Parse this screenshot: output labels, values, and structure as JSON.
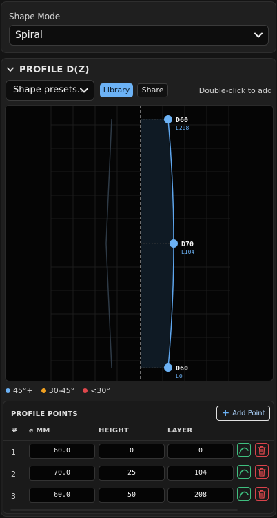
{
  "shape_mode": {
    "label": "Shape Mode",
    "selected": "Spiral"
  },
  "profile": {
    "title": "PROFILE D(Z)",
    "presets_selected": "Shape presets...",
    "library_label": "Library",
    "share_label": "Share",
    "hint": "Double-click to add"
  },
  "canvas": {
    "points": [
      {
        "d_label": "D60",
        "l_label": "L208"
      },
      {
        "d_label": "D70",
        "l_label": "L104"
      },
      {
        "d_label": "D60",
        "l_label": "L0"
      }
    ]
  },
  "legend": [
    {
      "label": "45°+",
      "color": "#6cb2f5"
    },
    {
      "label": "30-45°",
      "color": "#f0a020"
    },
    {
      "label": "<30°",
      "color": "#e0474c"
    }
  ],
  "points_table": {
    "title": "PROFILE POINTS",
    "add_label": "Add Point",
    "headers": {
      "num": "#",
      "mm": "⌀ MM",
      "height": "HEIGHT",
      "layer": "LAYER"
    },
    "rows": [
      {
        "num": "1",
        "mm": "60.0",
        "height": "0",
        "layer": "0"
      },
      {
        "num": "2",
        "mm": "70.0",
        "height": "25",
        "layer": "104"
      },
      {
        "num": "3",
        "mm": "60.0",
        "height": "50",
        "layer": "208"
      }
    ]
  },
  "colors": {
    "accent": "#6cb2f5",
    "good": "#3fbf7f",
    "danger": "#d9434b"
  }
}
